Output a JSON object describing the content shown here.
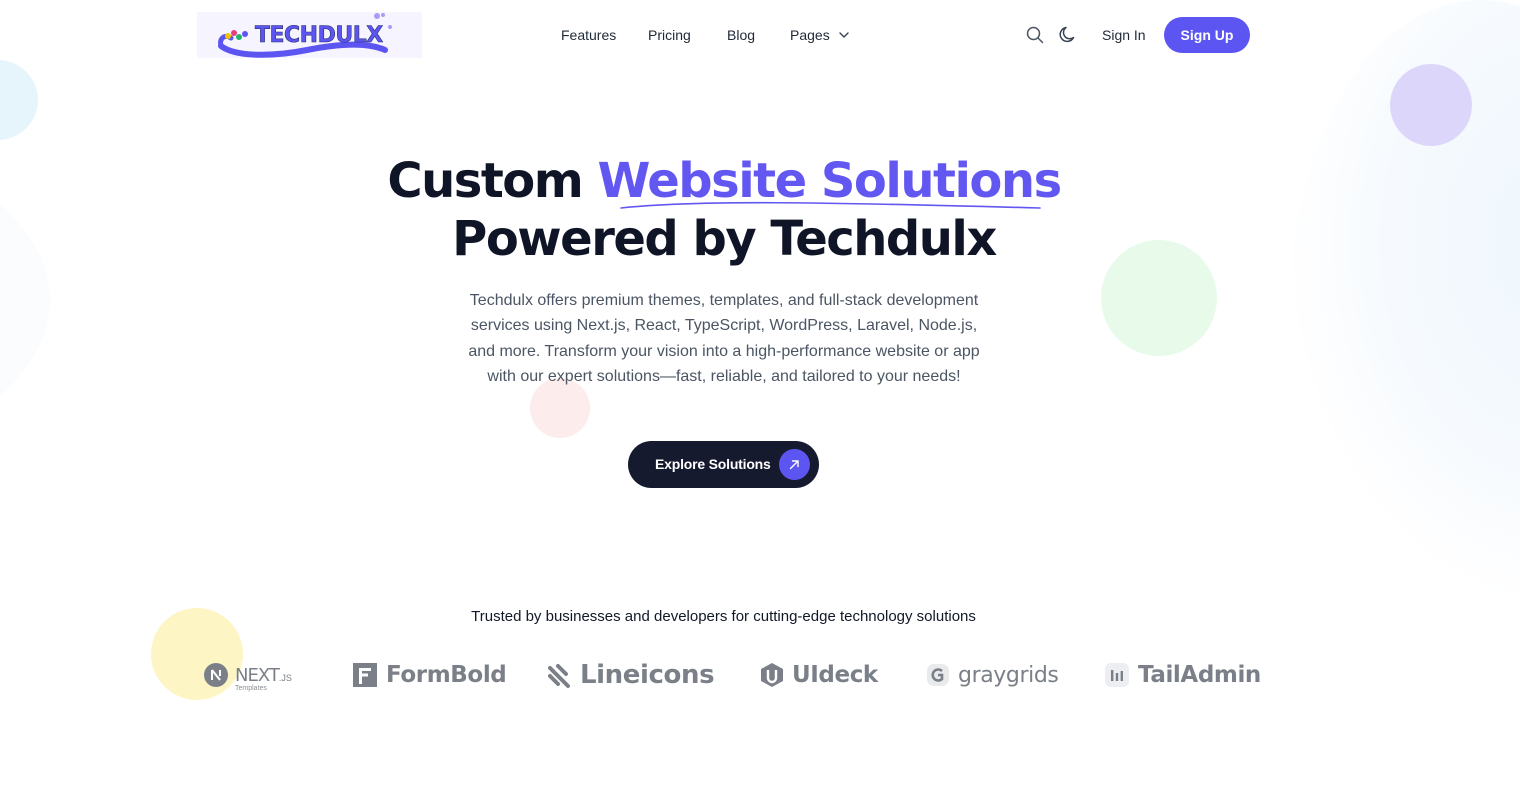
{
  "brand": {
    "logo_text": "TECHDULX",
    "accent_color": "#5d55f2",
    "dark_color": "#151a2e"
  },
  "nav": {
    "items": [
      {
        "label": "Features"
      },
      {
        "label": "Pricing"
      },
      {
        "label": "Blog"
      },
      {
        "label": "Pages"
      }
    ],
    "search_icon": "search-icon",
    "theme_icon": "moon-icon",
    "sign_in": "Sign In",
    "sign_up": "Sign Up"
  },
  "hero": {
    "title_part1": "Custom ",
    "title_accent": "Website Solutions",
    "title_line2": "Powered by Techdulx",
    "description": "Techdulx offers premium themes, templates, and full-stack development services using Next.js, React, TypeScript, WordPress, Laravel, Node.js, and more. Transform your vision into a high-performance website or app with our expert solutions—fast, reliable, and tailored to your needs!",
    "cta_label": "Explore Solutions",
    "cta_icon": "arrow-up-right-icon"
  },
  "trusted": {
    "heading": "Trusted by businesses and developers for cutting-edge technology solutions",
    "brands": [
      {
        "name": "NEXT",
        "suffix": ".JS",
        "sub": "Templates"
      },
      {
        "name": "FormBold"
      },
      {
        "name": "Lineicons"
      },
      {
        "name": "UIdeck"
      },
      {
        "name": "graygrids"
      },
      {
        "name": "TailAdmin"
      }
    ]
  }
}
